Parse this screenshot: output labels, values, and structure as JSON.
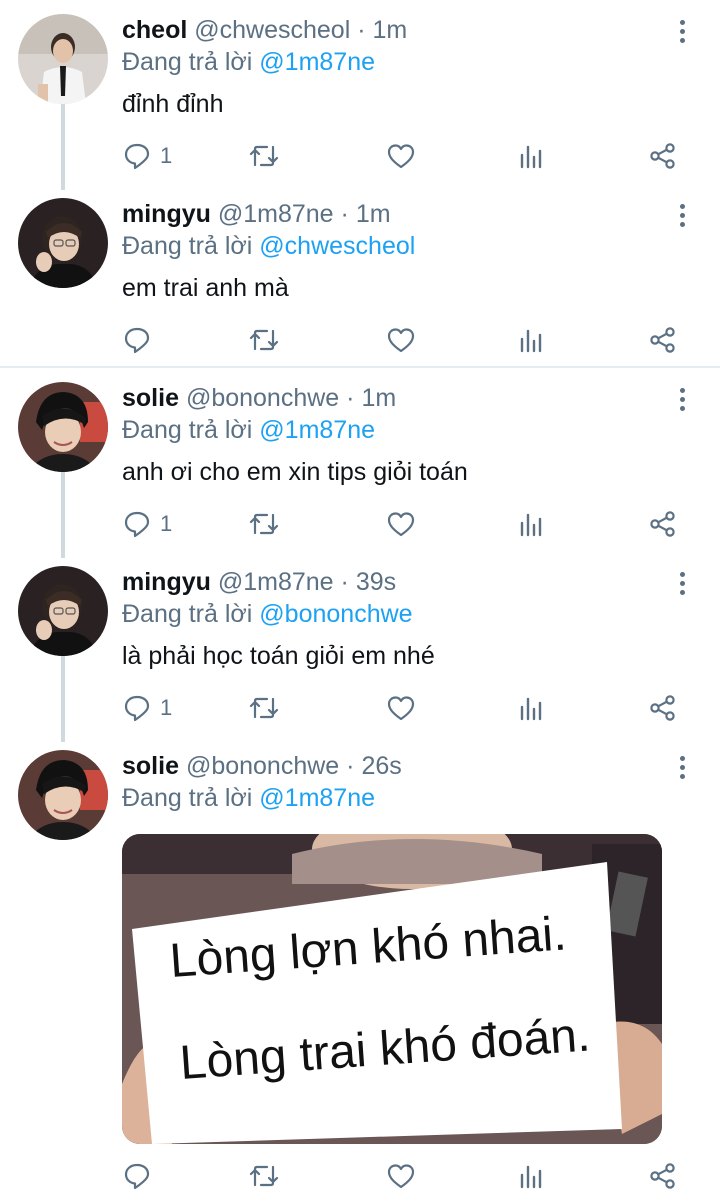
{
  "reply_prefix": "Đang trả lời",
  "tweets": [
    {
      "name": "cheol",
      "handle": "@chwescheol",
      "time": "1m",
      "reply_to": "@1m87ne",
      "text": "đỉnh đỉnh",
      "reply_count": "1"
    },
    {
      "name": "mingyu",
      "handle": "@1m87ne",
      "time": "1m",
      "reply_to": "@chwescheol",
      "text": "em trai anh mà",
      "reply_count": ""
    },
    {
      "name": "solie",
      "handle": "@bononchwe",
      "time": "1m",
      "reply_to": "@1m87ne",
      "text": "anh ơi cho em xin tips giỏi toán",
      "reply_count": "1"
    },
    {
      "name": "mingyu",
      "handle": "@1m87ne",
      "time": "39s",
      "reply_to": "@bononchwe",
      "text": "là phải học toán giỏi em nhé",
      "reply_count": "1"
    },
    {
      "name": "solie",
      "handle": "@bononchwe",
      "time": "26s",
      "reply_to": "@1m87ne",
      "text": "",
      "reply_count": "",
      "image_sign_lines": [
        "Lòng lợn khó nhai.",
        "Lòng trai khó đoán."
      ]
    }
  ],
  "separator": "·",
  "colors": {
    "accent": "#1da1f2",
    "muted": "#5b7083",
    "text": "#0f1419",
    "thread_line": "#cfd9de"
  },
  "icons": [
    "comment-icon",
    "retweet-icon",
    "like-icon",
    "analytics-icon",
    "share-icon",
    "more-options-icon"
  ]
}
